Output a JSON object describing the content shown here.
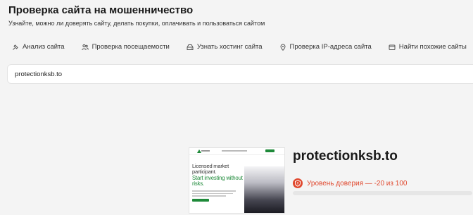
{
  "header": {
    "title": "Проверка сайта на мошенничество",
    "subtitle": "Узнайте, можно ли доверять сайту, делать покупки, оплачивать и пользоваться сайтом"
  },
  "nav": {
    "items": [
      {
        "label": "Анализ сайта",
        "icon": "analysis-icon"
      },
      {
        "label": "Проверка посещаемости",
        "icon": "people-icon"
      },
      {
        "label": "Узнать хостинг сайта",
        "icon": "server-icon"
      },
      {
        "label": "Проверка IP-адреса сайта",
        "icon": "location-pin-icon"
      },
      {
        "label": "Найти похожие сайты",
        "icon": "browser-window-icon"
      }
    ]
  },
  "search": {
    "value": "protectionksb.to"
  },
  "result": {
    "site_name": "protectionksb.to",
    "trust_label": "Уровень доверия — -20 из 100",
    "trust_score": -20,
    "trust_max": 100,
    "trust_color": "#e0492f",
    "preview": {
      "headline": "Licensed market participant.",
      "tagline": "Start investing without risks.",
      "accent_color": "#1f8a3a"
    }
  }
}
